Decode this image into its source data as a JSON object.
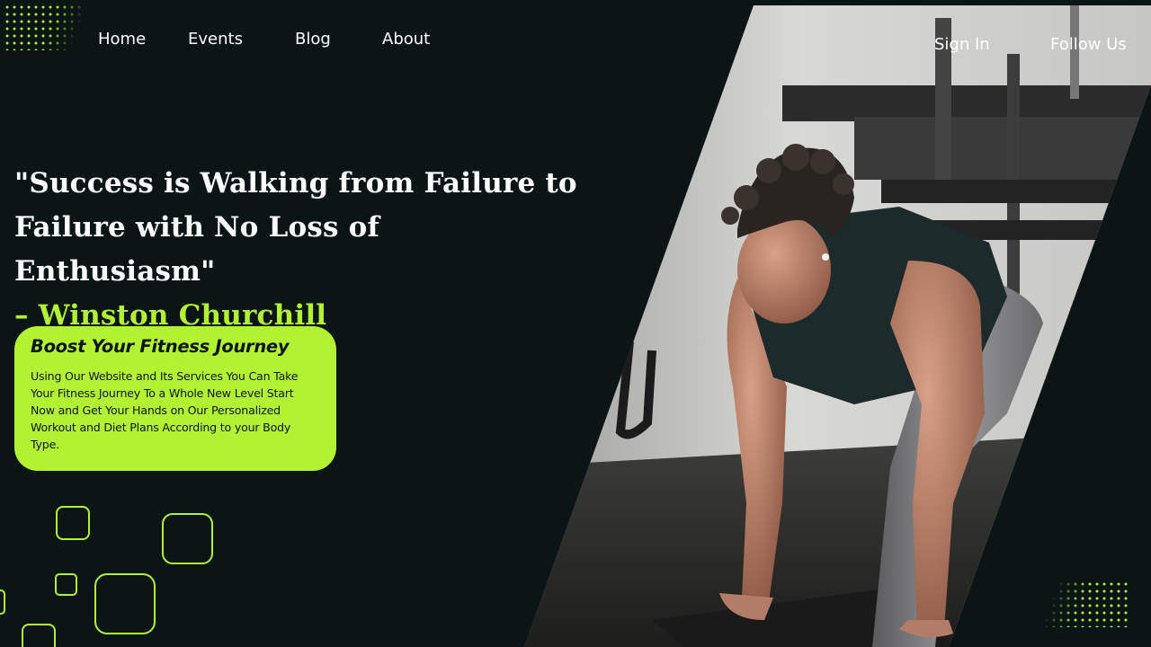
{
  "colors": {
    "background": "#0c1516",
    "accent": "#b3f233",
    "text": "#ffffff"
  },
  "nav": {
    "left": [
      {
        "label": "Home"
      },
      {
        "label": "Events"
      },
      {
        "label": "Blog"
      },
      {
        "label": "About"
      }
    ],
    "right": [
      {
        "label": "Sign In"
      },
      {
        "label": "Follow Us"
      }
    ]
  },
  "hero": {
    "quote_line1": "\"Success is Walking from Failure to",
    "quote_line2": "Failure with No Loss of Enthusiasm\"",
    "author": "– Winston Churchill"
  },
  "card": {
    "title": "Boost Your Fitness Journey",
    "body": "Using Our Website and Its Services You Can Take Your Fitness Journey To a Whole New Level Start Now and Get Your Hands on Our Personalized Workout and Diet Plans According to your Body Type."
  },
  "photo": {
    "icon": "athlete-photo"
  }
}
